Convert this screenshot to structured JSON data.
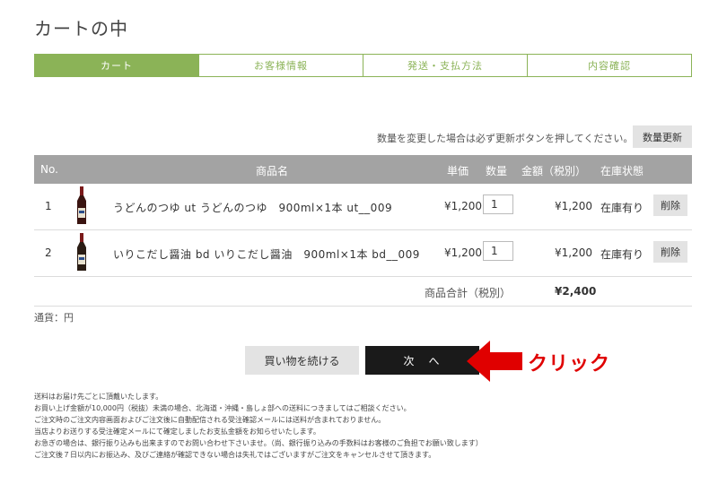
{
  "page_title": "カートの中",
  "steps": [
    "カート",
    "お客様情報",
    "発送・支払方法",
    "内容確認"
  ],
  "update_note": "数量を変更した場合は必ず更新ボタンを押してください。",
  "update_button": "数量更新",
  "table_headers": {
    "no": "No.",
    "product": "商品名",
    "unit_price": "単価",
    "quantity": "数量",
    "amount": "金額（税別）",
    "stock": "在庫状態"
  },
  "rows": [
    {
      "no": "1",
      "name": "うどんのつゆ ut うどんのつゆ　900ml×1本 ut__009",
      "price": "¥1,200",
      "qty": "1",
      "amount": "¥1,200",
      "stock": "在庫有り",
      "delete": "削除"
    },
    {
      "no": "2",
      "name": "いりこだし醤油 bd いりこだし醤油　900ml×1本 bd__009",
      "price": "¥1,200",
      "qty": "1",
      "amount": "¥1,200",
      "stock": "在庫有り",
      "delete": "削除"
    }
  ],
  "subtotal": {
    "label": "商品合計（税別）",
    "value": "¥2,400"
  },
  "currency_note": "通貨：円",
  "continue_button": "買い物を続ける",
  "next_button": "次　へ",
  "annotation": {
    "text": "クリック",
    "color": "#e00000"
  },
  "notes": [
    "送料はお届け先ごとに頂戴いたします。",
    "お買い上げ金額が10,000円（税抜）未満の場合、北海道・沖縄・島しょ部への送料につきましてはご相談ください。",
    "ご注文時のご注文内容画面およびご注文後に自動配信される受注確認メールには送料が含まれておりません。",
    "当店よりお送りする受注確定メールにて確定しましたお支払金額をお知らせいたします。",
    "お急ぎの場合は、銀行振り込みも出来ますのでお問い合わせ下さいませ。（尚、銀行振り込みの手数料はお客様のご負担でお願い致します）",
    "ご注文後７日以内にお振込み、及びご連絡が確認できない場合は失礼ではございますがご注文をキャンセルさせて頂きます。"
  ],
  "colors": {
    "accent": "#8bb357",
    "header_bg": "#a3a3a3",
    "next_button_bg": "#1a1a1a"
  }
}
